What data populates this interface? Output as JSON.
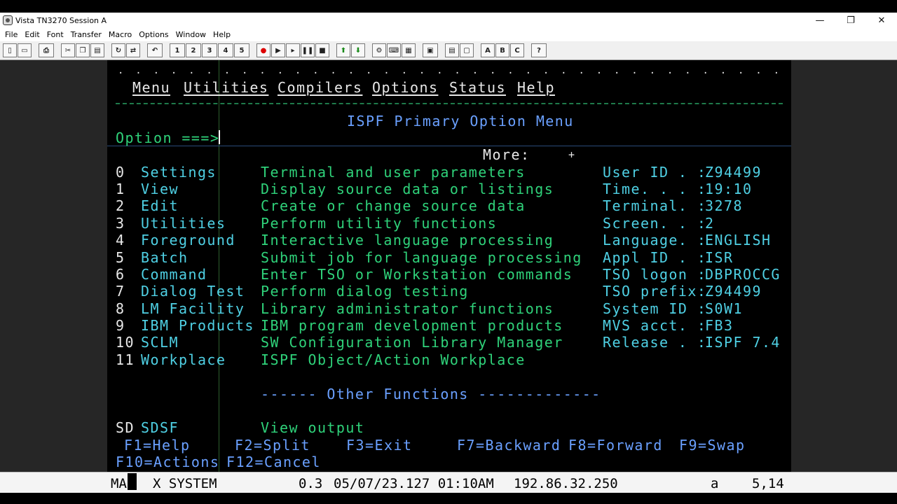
{
  "window": {
    "title": "Vista TN3270 Session A",
    "controls": [
      "—",
      "❐",
      "✕"
    ]
  },
  "menubar": [
    "File",
    "Edit",
    "Font",
    "Transfer",
    "Macro",
    "Options",
    "Window",
    "Help"
  ],
  "toolbar": {
    "macro_numbers": [
      "1",
      "2",
      "3",
      "4",
      "5"
    ],
    "letter_buttons": [
      "A",
      "B",
      "C"
    ],
    "help_button": "?"
  },
  "screen": {
    "dots": ".  .  .  .  .  .  .  .  .  .  .  .  .  .  .  .  .  .  .  .  .  .  .  .  .  .  .  .  .  .  .  .  .  .  .  .  .  .  .  .  .  .  .  .  .  .  .  .  .  .  .",
    "action_bar": [
      "Menu",
      "Utilities",
      "Compilers",
      "Options",
      "Status",
      "Help"
    ],
    "title": "ISPF Primary Option Menu",
    "option_prompt": "Option ===>",
    "more_label": "More:",
    "more_indicator": "+",
    "options": [
      {
        "num": "0",
        "name": "Settings",
        "desc": "Terminal and user parameters"
      },
      {
        "num": "1",
        "name": "View",
        "desc": "Display source data or listings"
      },
      {
        "num": "2",
        "name": "Edit",
        "desc": "Create or change source data"
      },
      {
        "num": "3",
        "name": "Utilities",
        "desc": "Perform utility functions"
      },
      {
        "num": "4",
        "name": "Foreground",
        "desc": "Interactive language processing"
      },
      {
        "num": "5",
        "name": "Batch",
        "desc": "Submit job for language processing"
      },
      {
        "num": "6",
        "name": "Command",
        "desc": "Enter TSO or Workstation commands"
      },
      {
        "num": "7",
        "name": "Dialog Test",
        "desc": "Perform dialog testing"
      },
      {
        "num": "8",
        "name": "LM Facility",
        "desc": "Library administrator functions"
      },
      {
        "num": "9",
        "name": "IBM Products",
        "desc": "IBM program development products"
      },
      {
        "num": "10",
        "name": "SCLM",
        "desc": "SW Configuration Library Manager"
      },
      {
        "num": "11",
        "name": "Workplace",
        "desc": "ISPF Object/Action Workplace"
      }
    ],
    "info": [
      {
        "label": "User ID . :",
        "value": "Z94499"
      },
      {
        "label": "Time. . . :",
        "value": "19:10"
      },
      {
        "label": "Terminal. :",
        "value": "3278"
      },
      {
        "label": "Screen. . :",
        "value": "2"
      },
      {
        "label": "Language. :",
        "value": "ENGLISH"
      },
      {
        "label": "Appl ID . :",
        "value": "ISR"
      },
      {
        "label": "TSO logon :",
        "value": "DBPROCCG"
      },
      {
        "label": "TSO prefix:",
        "value": "Z94499"
      },
      {
        "label": "System ID :",
        "value": "S0W1"
      },
      {
        "label": "MVS acct. :",
        "value": "FB3"
      },
      {
        "label": "Release . :",
        "value": "ISPF 7.4"
      }
    ],
    "other_functions": "------ Other Functions -------------",
    "sdsf_code": "SD",
    "sdsf_name": "SDSF",
    "sdsf_desc": "View output",
    "fkeys_row1": [
      "F1=Help",
      "F2=Split",
      "F3=Exit",
      "F7=Backward",
      "F8=Forward",
      "F9=Swap"
    ],
    "fkeys_row2": [
      "F10=Actions",
      "F12=Cancel"
    ]
  },
  "status": {
    "ma": "MA",
    "system": "X SYSTEM",
    "timing": "0.3",
    "datetime": "05/07/23.127 01:10AM",
    "ip": "192.86.32.250",
    "mode": "a",
    "cursor_pos": "5,14"
  }
}
